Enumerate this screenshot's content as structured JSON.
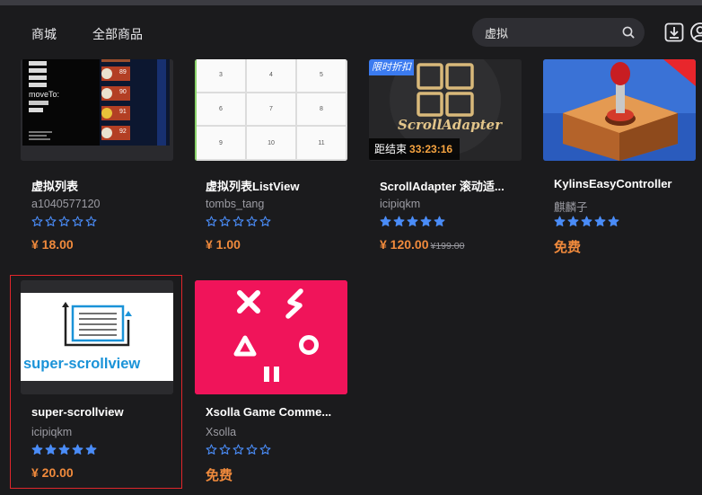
{
  "header": {
    "nav": [
      {
        "label": "商城"
      },
      {
        "label": "全部商品"
      }
    ],
    "search": {
      "value": "虚拟"
    },
    "icons": {
      "search": "search-icon",
      "download": "download-icon",
      "account": "account-icon"
    }
  },
  "colors": {
    "background": "#1b1b1d",
    "accent_price": "#f08a3c",
    "star": "#4a8cf7",
    "sale_badge": "#3b7bf0",
    "countdown": "#f6a441",
    "selection": "#e0262b"
  },
  "products": [
    {
      "title": "虚拟列表",
      "author": "a1040577120",
      "rating": 0,
      "price": "¥ 18.00",
      "thumb_labels": [
        "moveTo:"
      ],
      "thumb_values": [
        "89",
        "90",
        "91",
        "92"
      ]
    },
    {
      "title": "虚拟列表ListView",
      "author": "tombs_tang",
      "rating": 0,
      "price": "¥ 1.00",
      "grid": [
        "3",
        "4",
        "5",
        "6",
        "7",
        "8",
        "9",
        "10",
        "11"
      ]
    },
    {
      "title": "ScrollAdapter 滚动适...",
      "author": "icipiqkm",
      "rating": 5,
      "price": "¥ 120.00",
      "old_price": "¥199.00",
      "badge": "限时折扣",
      "countdown_label": "距结束",
      "countdown": "33:23:16",
      "thumb_text": "ScrollAdapter"
    },
    {
      "title": "KylinsEasyController",
      "author": "麒麟子",
      "rating": 5,
      "price": "免费"
    },
    {
      "title": "super-scrollview",
      "author": "icipiqkm",
      "rating": 5,
      "price": "¥ 20.00",
      "thumb_text": "super-scrollview",
      "selected": true
    },
    {
      "title": "Xsolla Game Comme...",
      "author": "Xsolla",
      "rating": 0,
      "price": "免费"
    }
  ]
}
